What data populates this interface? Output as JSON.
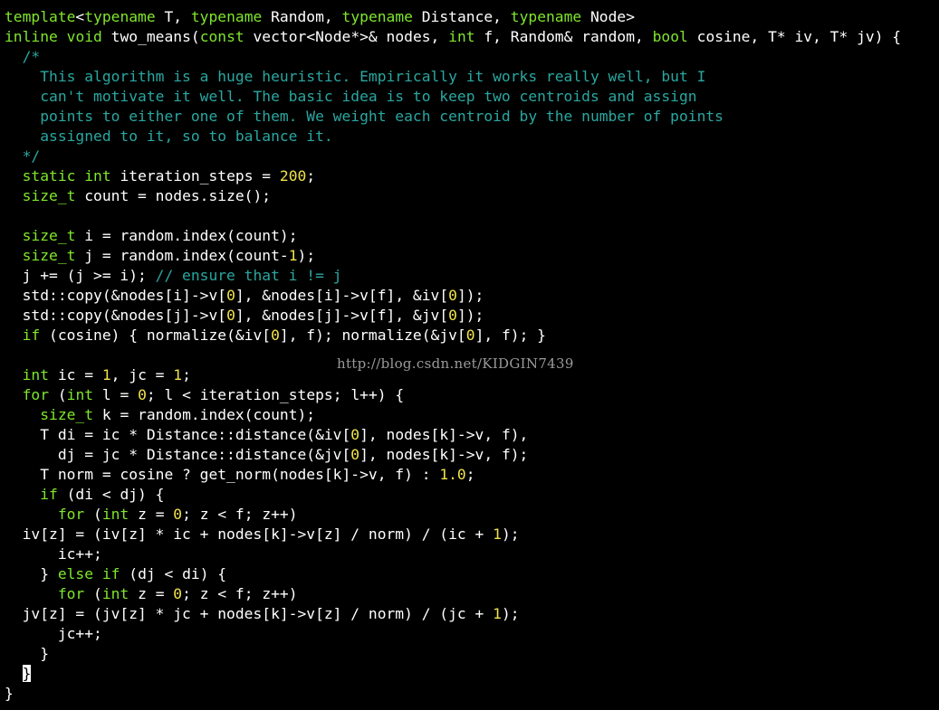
{
  "colors": {
    "background": "#000000",
    "default_text": "#ffffff",
    "keyword": "#7fe62c",
    "number": "#f0e24a",
    "comment": "#2aa7a0",
    "watermark": "#9a9a9a"
  },
  "code_lines": [
    [
      {
        "t": "kw",
        "v": "template"
      },
      {
        "t": "plain",
        "v": "<"
      },
      {
        "t": "kw",
        "v": "typename"
      },
      {
        "t": "plain",
        "v": " T, "
      },
      {
        "t": "kw",
        "v": "typename"
      },
      {
        "t": "plain",
        "v": " Random, "
      },
      {
        "t": "kw",
        "v": "typename"
      },
      {
        "t": "plain",
        "v": " Distance, "
      },
      {
        "t": "kw",
        "v": "typename"
      },
      {
        "t": "plain",
        "v": " Node>"
      }
    ],
    [
      {
        "t": "kw",
        "v": "inline"
      },
      {
        "t": "plain",
        "v": " "
      },
      {
        "t": "kw",
        "v": "void"
      },
      {
        "t": "plain",
        "v": " two_means("
      },
      {
        "t": "kw",
        "v": "const"
      },
      {
        "t": "plain",
        "v": " vector<Node*>& nodes, "
      },
      {
        "t": "kw",
        "v": "int"
      },
      {
        "t": "plain",
        "v": " f, Random& random, "
      },
      {
        "t": "kw",
        "v": "bool"
      },
      {
        "t": "plain",
        "v": " cosine, T* iv, T* jv) {"
      }
    ],
    [
      {
        "t": "cmt",
        "v": "  /*"
      }
    ],
    [
      {
        "t": "cmt",
        "v": "    This algorithm is a huge heuristic. Empirically it works really well, but I"
      }
    ],
    [
      {
        "t": "cmt",
        "v": "    can't motivate it well. The basic idea is to keep two centroids and assign"
      }
    ],
    [
      {
        "t": "cmt",
        "v": "    points to either one of them. We weight each centroid by the number of points"
      }
    ],
    [
      {
        "t": "cmt",
        "v": "    assigned to it, so to balance it."
      }
    ],
    [
      {
        "t": "cmt",
        "v": "  */"
      }
    ],
    [
      {
        "t": "plain",
        "v": "  "
      },
      {
        "t": "kw",
        "v": "static"
      },
      {
        "t": "plain",
        "v": " "
      },
      {
        "t": "kw",
        "v": "int"
      },
      {
        "t": "plain",
        "v": " iteration_steps = "
      },
      {
        "t": "num",
        "v": "200"
      },
      {
        "t": "plain",
        "v": ";"
      }
    ],
    [
      {
        "t": "plain",
        "v": "  "
      },
      {
        "t": "kw",
        "v": "size_t"
      },
      {
        "t": "plain",
        "v": " count = nodes.size();"
      }
    ],
    [],
    [
      {
        "t": "plain",
        "v": "  "
      },
      {
        "t": "kw",
        "v": "size_t"
      },
      {
        "t": "plain",
        "v": " i = random.index(count);"
      }
    ],
    [
      {
        "t": "plain",
        "v": "  "
      },
      {
        "t": "kw",
        "v": "size_t"
      },
      {
        "t": "plain",
        "v": " j = random.index(count-"
      },
      {
        "t": "num",
        "v": "1"
      },
      {
        "t": "plain",
        "v": ");"
      }
    ],
    [
      {
        "t": "plain",
        "v": "  j += (j >= i); "
      },
      {
        "t": "cmt",
        "v": "// ensure that i != j"
      }
    ],
    [
      {
        "t": "plain",
        "v": "  std::copy(&nodes[i]->v["
      },
      {
        "t": "num",
        "v": "0"
      },
      {
        "t": "plain",
        "v": "], &nodes[i]->v[f], &iv["
      },
      {
        "t": "num",
        "v": "0"
      },
      {
        "t": "plain",
        "v": "]);"
      }
    ],
    [
      {
        "t": "plain",
        "v": "  std::copy(&nodes[j]->v["
      },
      {
        "t": "num",
        "v": "0"
      },
      {
        "t": "plain",
        "v": "], &nodes[j]->v[f], &jv["
      },
      {
        "t": "num",
        "v": "0"
      },
      {
        "t": "plain",
        "v": "]);"
      }
    ],
    [
      {
        "t": "plain",
        "v": "  "
      },
      {
        "t": "kw",
        "v": "if"
      },
      {
        "t": "plain",
        "v": " (cosine) { normalize(&iv["
      },
      {
        "t": "num",
        "v": "0"
      },
      {
        "t": "plain",
        "v": "], f); normalize(&jv["
      },
      {
        "t": "num",
        "v": "0"
      },
      {
        "t": "plain",
        "v": "], f); }"
      }
    ],
    [],
    [
      {
        "t": "plain",
        "v": "  "
      },
      {
        "t": "kw",
        "v": "int"
      },
      {
        "t": "plain",
        "v": " ic = "
      },
      {
        "t": "num",
        "v": "1"
      },
      {
        "t": "plain",
        "v": ", jc = "
      },
      {
        "t": "num",
        "v": "1"
      },
      {
        "t": "plain",
        "v": ";"
      }
    ],
    [
      {
        "t": "plain",
        "v": "  "
      },
      {
        "t": "kw",
        "v": "for"
      },
      {
        "t": "plain",
        "v": " ("
      },
      {
        "t": "kw",
        "v": "int"
      },
      {
        "t": "plain",
        "v": " l = "
      },
      {
        "t": "num",
        "v": "0"
      },
      {
        "t": "plain",
        "v": "; l < iteration_steps; l++) {"
      }
    ],
    [
      {
        "t": "plain",
        "v": "    "
      },
      {
        "t": "kw",
        "v": "size_t"
      },
      {
        "t": "plain",
        "v": " k = random.index(count);"
      }
    ],
    [
      {
        "t": "plain",
        "v": "    T di = ic * Distance::distance(&iv["
      },
      {
        "t": "num",
        "v": "0"
      },
      {
        "t": "plain",
        "v": "], nodes[k]->v, f),"
      }
    ],
    [
      {
        "t": "plain",
        "v": "      dj = jc * Distance::distance(&jv["
      },
      {
        "t": "num",
        "v": "0"
      },
      {
        "t": "plain",
        "v": "], nodes[k]->v, f);"
      }
    ],
    [
      {
        "t": "plain",
        "v": "    T norm = cosine ? get_norm(nodes[k]->v, f) : "
      },
      {
        "t": "num",
        "v": "1.0"
      },
      {
        "t": "plain",
        "v": ";"
      }
    ],
    [
      {
        "t": "plain",
        "v": "    "
      },
      {
        "t": "kw",
        "v": "if"
      },
      {
        "t": "plain",
        "v": " (di < dj) {"
      }
    ],
    [
      {
        "t": "plain",
        "v": "      "
      },
      {
        "t": "kw",
        "v": "for"
      },
      {
        "t": "plain",
        "v": " ("
      },
      {
        "t": "kw",
        "v": "int"
      },
      {
        "t": "plain",
        "v": " z = "
      },
      {
        "t": "num",
        "v": "0"
      },
      {
        "t": "plain",
        "v": "; z < f; z++)"
      }
    ],
    [
      {
        "t": "plain",
        "v": "  iv[z] = (iv[z] * ic + nodes[k]->v[z] / norm) / (ic + "
      },
      {
        "t": "num",
        "v": "1"
      },
      {
        "t": "plain",
        "v": ");"
      }
    ],
    [
      {
        "t": "plain",
        "v": "      ic++;"
      }
    ],
    [
      {
        "t": "plain",
        "v": "    } "
      },
      {
        "t": "kw",
        "v": "else"
      },
      {
        "t": "plain",
        "v": " "
      },
      {
        "t": "kw",
        "v": "if"
      },
      {
        "t": "plain",
        "v": " (dj < di) {"
      }
    ],
    [
      {
        "t": "plain",
        "v": "      "
      },
      {
        "t": "kw",
        "v": "for"
      },
      {
        "t": "plain",
        "v": " ("
      },
      {
        "t": "kw",
        "v": "int"
      },
      {
        "t": "plain",
        "v": " z = "
      },
      {
        "t": "num",
        "v": "0"
      },
      {
        "t": "plain",
        "v": "; z < f; z++)"
      }
    ],
    [
      {
        "t": "plain",
        "v": "  jv[z] = (jv[z] * jc + nodes[k]->v[z] / norm) / (jc + "
      },
      {
        "t": "num",
        "v": "1"
      },
      {
        "t": "plain",
        "v": ");"
      }
    ],
    [
      {
        "t": "plain",
        "v": "      jc++;"
      }
    ],
    [
      {
        "t": "plain",
        "v": "    }"
      }
    ],
    [
      {
        "t": "plain",
        "v": "  "
      },
      {
        "t": "cursor",
        "v": "}"
      }
    ],
    [
      {
        "t": "plain",
        "v": "}"
      }
    ]
  ],
  "watermark": "http://blog.csdn.net/KIDGIN7439"
}
